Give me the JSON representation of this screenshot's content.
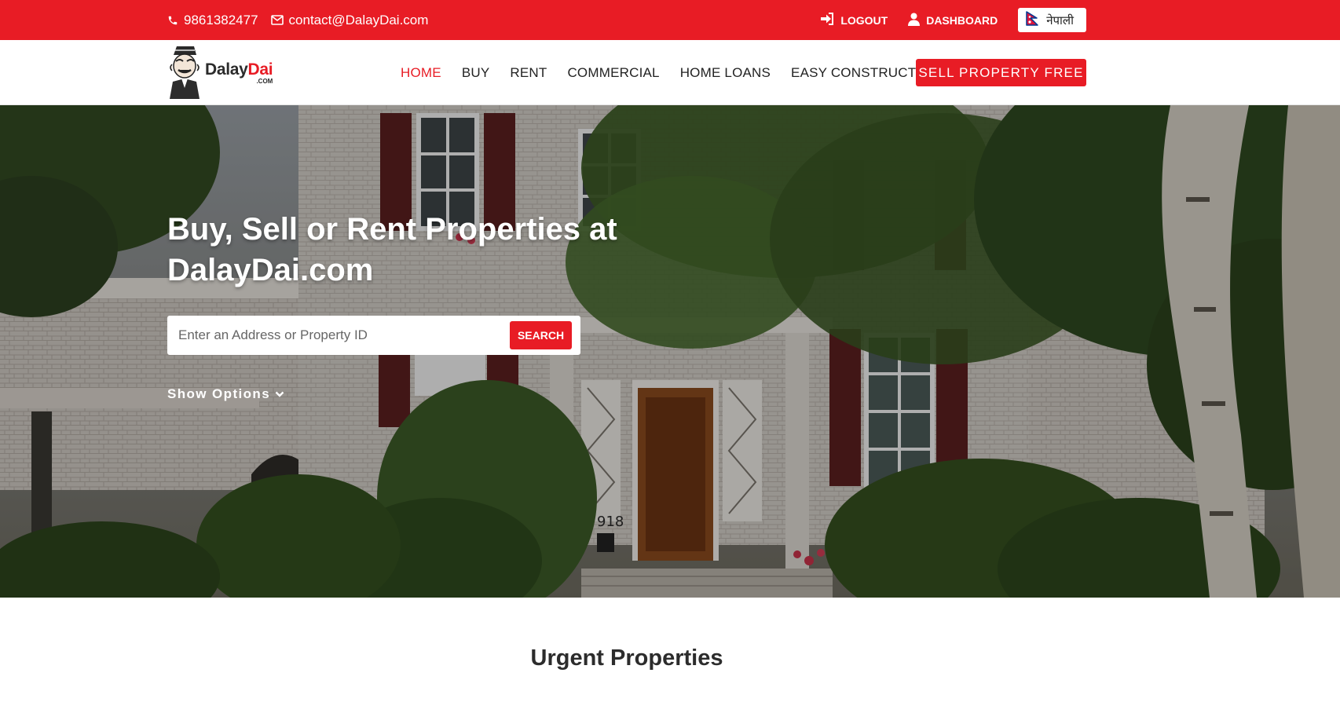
{
  "topbar": {
    "phone": "9861382477",
    "email": "contact@DalayDai.com",
    "logout_label": "LOGOUT",
    "dashboard_label": "DASHBOARD",
    "language_label": "नेपाली",
    "background_color": "#e81c25"
  },
  "logo": {
    "name_dark": "Dalay",
    "name_red": "Dai",
    "tld": ".COM"
  },
  "nav": {
    "items": [
      {
        "label": "HOME",
        "active": true
      },
      {
        "label": "BUY",
        "active": false
      },
      {
        "label": "RENT",
        "active": false
      },
      {
        "label": "COMMERCIAL",
        "active": false
      },
      {
        "label": "HOME LOANS",
        "active": false
      },
      {
        "label": "EASY CONSTRUCTION",
        "active": false
      }
    ],
    "cta_label": "SELL PROPERTY FREE"
  },
  "hero": {
    "title": "Buy, Sell or Rent Properties at DalayDai.com",
    "search_placeholder": "Enter an Address or Property ID",
    "search_value": "",
    "search_button_label": "SEARCH",
    "show_options_label": "Show Options",
    "house_number": "918"
  },
  "sections": {
    "urgent_title": "Urgent Properties"
  },
  "colors": {
    "accent": "#e81c25",
    "nav_active": "#e81c25"
  }
}
